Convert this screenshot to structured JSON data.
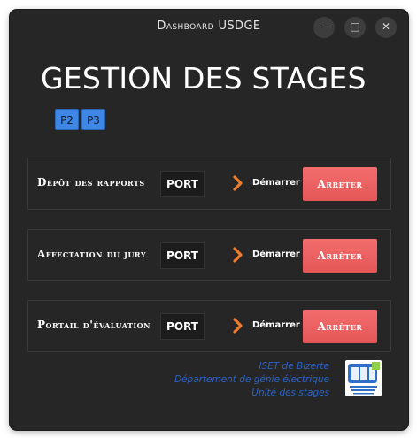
{
  "window": {
    "title": "Dashboard USDGE",
    "controls": {
      "minimize": "—",
      "maximize": "□",
      "close": "✕"
    }
  },
  "main": {
    "heading": "GESTION DES STAGES",
    "phase_buttons": [
      "P2",
      "P3"
    ]
  },
  "services": [
    {
      "label": "Dépôt des rapports",
      "port": "PORT",
      "start_label": "Démarrer",
      "stop_label": "Arrêter"
    },
    {
      "label": "Affectation du jury",
      "port": "PORT",
      "start_label": "Démarrer",
      "stop_label": "Arrêter"
    },
    {
      "label": "Portail d'évaluation",
      "port": "PORT",
      "start_label": "Démarrer",
      "stop_label": "Arrêter"
    }
  ],
  "footer": {
    "line1": "ISET de Bizerte",
    "line2": "Département de génie électrique",
    "line3": "Unité des stages",
    "logo_icon": "iset-logo"
  },
  "colors": {
    "background": "#262626",
    "stop_button": "#ef6464",
    "phase_button": "#3f87e6",
    "chevron": "#ef7d2c",
    "footer_text": "#2c63c7"
  }
}
